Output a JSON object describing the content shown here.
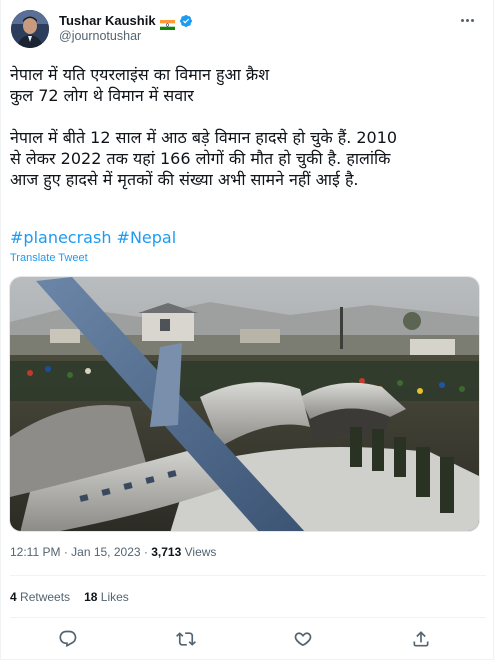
{
  "author": {
    "name": "Tushar Kaushik",
    "handle": "@journotushar"
  },
  "tweet": {
    "line1": "नेपाल में यति एयरलाइंस का विमान हुआ क्रैश\nकुल 72 लोग थे विमान में सवार",
    "line2": "नेपाल में बीते 12 साल में आठ बड़े विमान हादसे हो चुके हैं. 2010\nसे लेकर 2022 तक यहां  166 लोगों की मौत हो चुकी है. हालांकि\nआज हुए हादसे में मृतकों की संख्या अभी सामने नहीं आई है.",
    "hashtag1": "#planecrash",
    "hashtag2": "#Nepal",
    "translate_label": "Translate Tweet"
  },
  "meta": {
    "time": "12:11 PM",
    "separator": " · ",
    "date": "Jan 15, 2023",
    "views_count": "3,713",
    "views_label": "Views"
  },
  "stats": {
    "retweets_count": "4",
    "retweets_label": "Retweets",
    "likes_count": "18",
    "likes_label": "Likes"
  },
  "colors": {
    "link": "#1d9bf0",
    "secondary_text": "#536471",
    "verified": "#1d9bf0"
  },
  "icons": [
    "more-icon",
    "reply-icon",
    "retweet-icon",
    "like-icon",
    "share-icon",
    "verified-badge-icon",
    "india-flag-icon"
  ]
}
